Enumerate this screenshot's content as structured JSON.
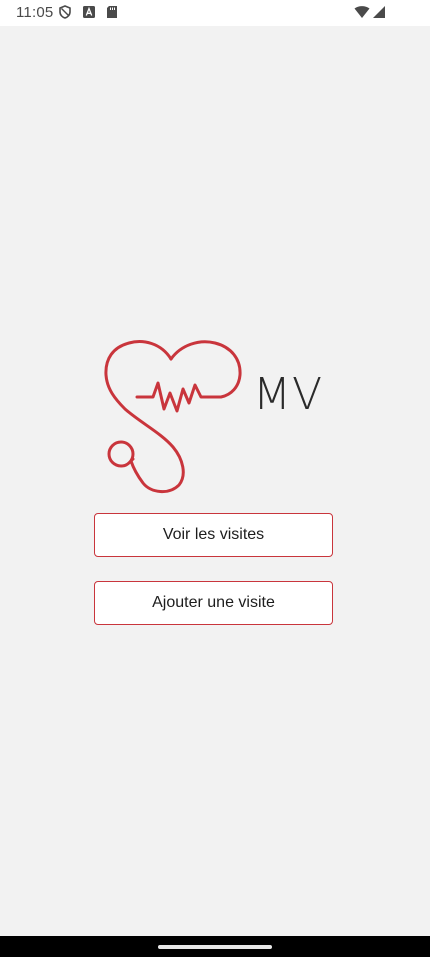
{
  "status_bar": {
    "time": "11:05",
    "icons": [
      "shield-icon",
      "text-a-icon",
      "sd-card-icon",
      "wifi-icon",
      "signal-icon"
    ]
  },
  "logo": {
    "text": "MV",
    "icon": "heart-stethoscope-icon",
    "color": "#c9353c"
  },
  "actions": {
    "view_visits": "Voir les visites",
    "add_visit": "Ajouter une visite"
  },
  "colors": {
    "accent": "#c9353c",
    "background": "#f2f2f2"
  }
}
